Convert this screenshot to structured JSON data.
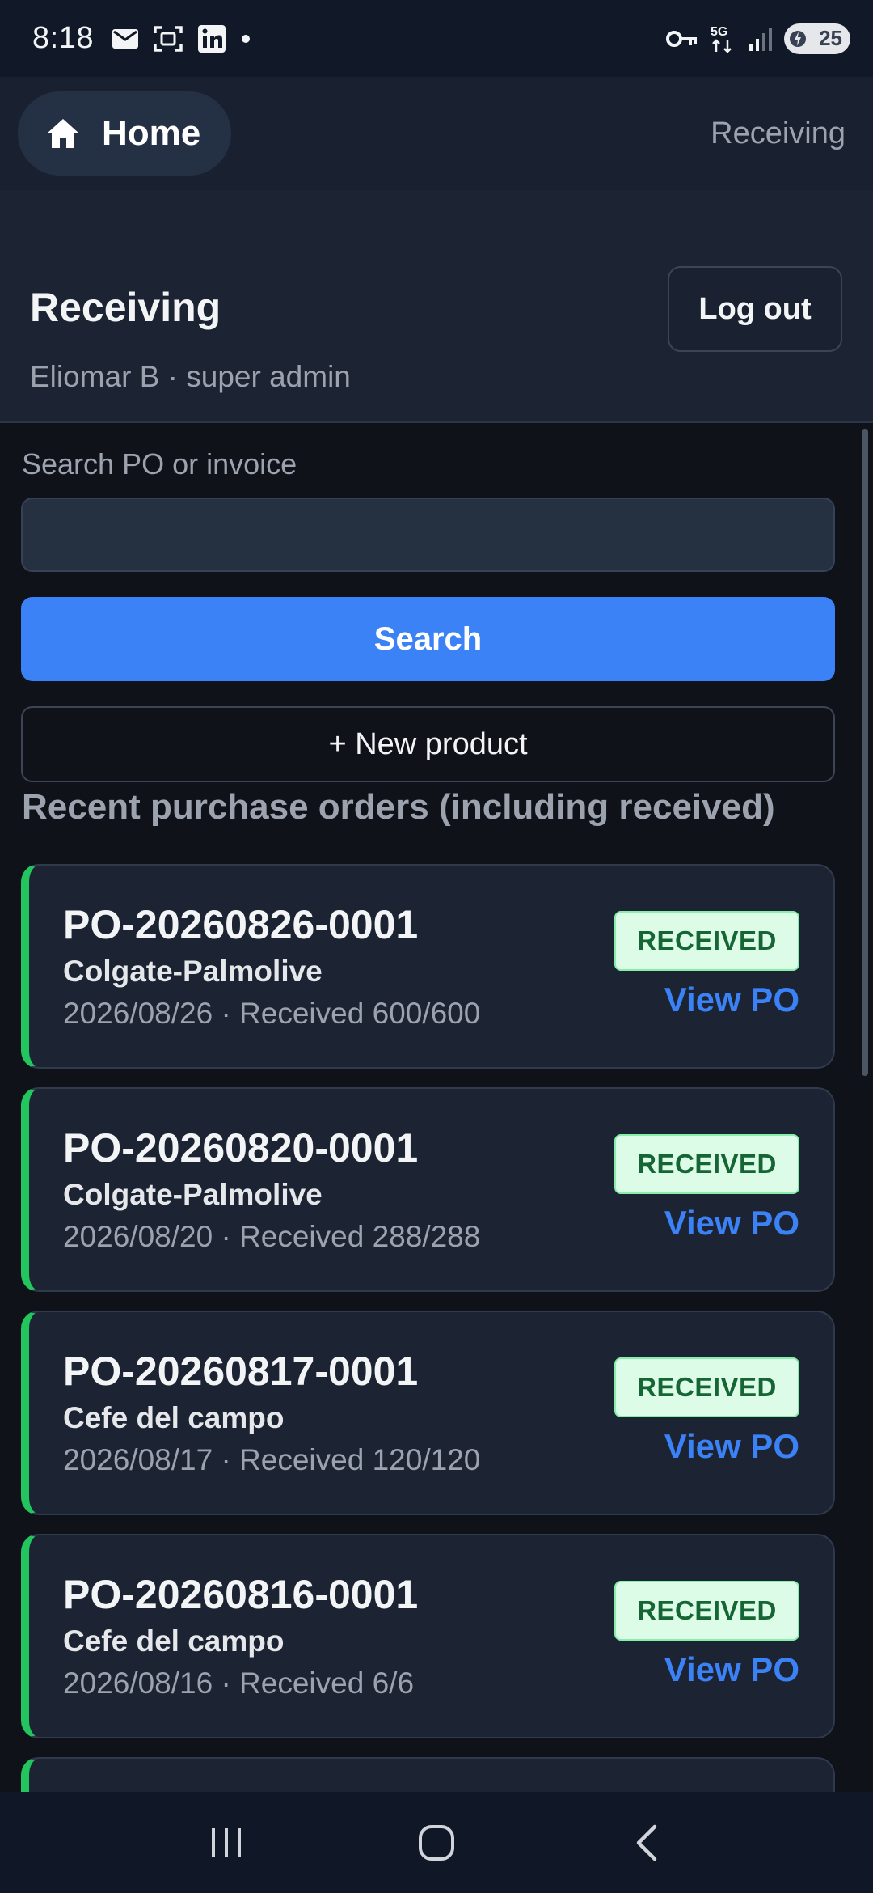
{
  "status_bar": {
    "time": "8:18",
    "left_icons": [
      "mail-icon",
      "screenshot-icon",
      "linkedin-icon",
      "dot-icon"
    ],
    "right_icons": [
      "vpn-key-icon",
      "5g-icon",
      "signal-icon"
    ],
    "battery_level": "25"
  },
  "nav": {
    "home_label": "Home",
    "current_page": "Receiving"
  },
  "header": {
    "title": "Receiving",
    "user_line": "Eliomar B · super admin",
    "logout_label": "Log out"
  },
  "search": {
    "label": "Search PO or invoice",
    "value": "",
    "button_label": "Search"
  },
  "new_product_label": "+ New product",
  "section_title": "Recent purchase orders (including received)",
  "accent_colors": {
    "primary": "#3b82f6",
    "received_border": "#22c55e",
    "badge_bg": "#dcfce7",
    "badge_text": "#166534"
  },
  "purchase_orders": [
    {
      "number": "PO-20260826-0001",
      "vendor": "Colgate-Palmolive",
      "meta": "2026/08/26 · Received 600/600",
      "status": "RECEIVED",
      "link": "View PO"
    },
    {
      "number": "PO-20260820-0001",
      "vendor": "Colgate-Palmolive",
      "meta": "2026/08/20 · Received 288/288",
      "status": "RECEIVED",
      "link": "View PO"
    },
    {
      "number": "PO-20260817-0001",
      "vendor": "Cefe del campo",
      "meta": "2026/08/17 · Received 120/120",
      "status": "RECEIVED",
      "link": "View PO"
    },
    {
      "number": "PO-20260816-0001",
      "vendor": "Cefe del campo",
      "meta": "2026/08/16 · Received 6/6",
      "status": "RECEIVED",
      "link": "View PO"
    }
  ],
  "system_nav": [
    "recents-icon",
    "home-circle-icon",
    "back-icon"
  ]
}
